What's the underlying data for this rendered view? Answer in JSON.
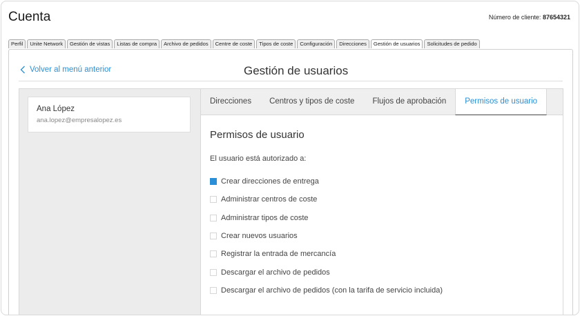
{
  "header": {
    "title": "Cuenta",
    "client_label": "Número de cliente:",
    "client_number": "87654321"
  },
  "tabs": [
    {
      "label": "Perfil",
      "active": false
    },
    {
      "label": "Unite Network",
      "active": false
    },
    {
      "label": "Gestión de vistas",
      "active": false
    },
    {
      "label": "Listas de compra",
      "active": false
    },
    {
      "label": "Archivo de pedidos",
      "active": false
    },
    {
      "label": "Centre de coste",
      "active": false
    },
    {
      "label": "Tipos de coste",
      "active": false
    },
    {
      "label": "Configuración",
      "active": false
    },
    {
      "label": "Direcciones",
      "active": false
    },
    {
      "label": "Gestión de usuarios",
      "active": true
    },
    {
      "label": "Solicitudes de pedido",
      "active": false
    }
  ],
  "back_label": "Volver al menú anterior",
  "page_heading": "Gestión de usuarios",
  "user": {
    "name": "Ana López",
    "email": "ana.lopez@empresalopez.es"
  },
  "subtabs": [
    {
      "label": "Direcciones",
      "active": false
    },
    {
      "label": "Centros y tipos de coste",
      "active": false
    },
    {
      "label": "Flujos de aprobación",
      "active": false
    },
    {
      "label": "Permisos de usuario",
      "active": true
    }
  ],
  "permissions": {
    "title": "Permisos de usuario",
    "intro": "El usuario está autorizado a:",
    "items": [
      {
        "label": "Crear direcciones de entrega",
        "checked": true
      },
      {
        "label": "Administrar centros de coste",
        "checked": false
      },
      {
        "label": "Administrar tipos de coste",
        "checked": false
      },
      {
        "label": "Crear nuevos usuarios",
        "checked": false
      },
      {
        "label": "Registrar la entrada de mercancía",
        "checked": false
      },
      {
        "label": "Descargar el archivo de pedidos",
        "checked": false
      },
      {
        "label": "Descargar el archivo de pedidos (con la tarifa de servicio incluida)",
        "checked": false
      }
    ]
  },
  "colors": {
    "accent": "#2a8fd6"
  }
}
